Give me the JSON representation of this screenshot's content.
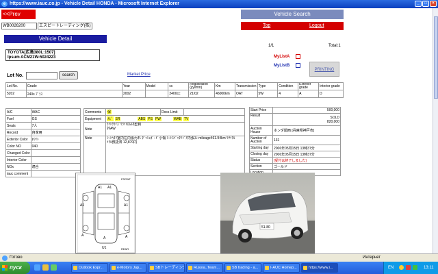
{
  "window": {
    "title": "https://www.iauc.co.jp - Vehicle Detail HONDA - Microsoft Internet Explorer"
  },
  "nav": {
    "prev": "<<Prev",
    "vehicle_search": "Vehicle Search",
    "top": "Top",
    "logout": "Logout"
  },
  "user": {
    "id": "WB0026200",
    "company": "エスピートレーディング(株)"
  },
  "detail": {
    "header": "Vehicle Detail",
    "page": "1/1",
    "total": "Total:1",
    "vehicle_line1": "TOYOTA[広島380L:1507]",
    "vehicle_line2": "Ipsum ACM21W-5024223",
    "mylist_a": "MyListA",
    "mylist_b": "MyListB",
    "printing": "PRINTING",
    "lot_label": "Lot No.",
    "search": "search",
    "market_price": "Market Price"
  },
  "spec": {
    "headers": [
      "Lot No.",
      "Grade",
      "Year",
      "Model",
      "cc",
      "Registration (yy/mm)",
      "Km",
      "Transmission",
      "Type",
      "Condition",
      "Exterior grade",
      "Interior grade"
    ],
    "values": [
      "5202",
      "240s ﾌﾟﾗｽ",
      "2002",
      "",
      "2400cc",
      "21/02",
      "46000km",
      "OAT",
      "5W",
      "4",
      "A",
      "D"
    ]
  },
  "info": {
    "ac_label": "A/C",
    "ac": "WAC",
    "fuel_label": "Fuel",
    "fuel": "GS",
    "seats_label": "Seats",
    "seats": "7人",
    "record_label": "Record",
    "record": "自家用",
    "ext_color_label": "Exterior Color",
    "ext_color": "ﾎﾜｲﾄ",
    "color_no_label": "Color NO",
    "color_no": "040",
    "changed_color_label": "Changed Color",
    "changed_color": "",
    "int_color_label": "Interior Color",
    "int_color": "",
    "nox_label": "NOx",
    "nox": "適合",
    "iauc_comment_label": "iauc comment",
    "iauc_comment": "",
    "comments_label": "Comments",
    "comments": "保",
    "docs_label": "Docs Limit",
    "docs": "",
    "equipment_label": "Equipment",
    "equipment": [
      "ﾅﾋﾞ",
      "SR",
      "ABS",
      "PS",
      "PW",
      "WAB",
      "TV"
    ],
    "note1_label": "Note",
    "note1_lines": [
      "ﾗｲﾄｸﾗｲｽﾞﾘﾗｲﾄﾛﾑﾙ3型目",
      "外AW"
    ],
    "note2_label": "Note",
    "note2_lines": [
      "ｼｰﾄﾍﾀﾘ室内左内張汚れ ﾀﾞｯｼｭﾎﾞｰﾄﾞ小傷 ｼｰﾄｽﾍﾞｯﾀﾘﾄﾞｱ内張ｽﾚ mileage461.94km ﾘｻｲｸﾙ",
      "ｲｸﾙ預託済 12,870円"
    ]
  },
  "auction": {
    "start_price_label": "Start Price",
    "start_price": "500,000",
    "result_label": "Result",
    "result_1": "SOLD",
    "result_2": "820,000",
    "auction_house_label": "Auction House",
    "auction_house": "ホンダ関西 [兵庫県神戸市]",
    "number_label": "Number of Auction",
    "number": "131",
    "starting_label": "Starting day",
    "starting": "2006年05月15日 13時37分",
    "closing_label": "Closing day",
    "closing": "2006年05月15日 13時37分",
    "status_label": "Status",
    "status": "[受付は終了しました]",
    "section_label": "Section",
    "section": "ゴールド",
    "location_label": "Location",
    "location": ""
  },
  "sheet": {
    "front": "FRONT",
    "rear": "REAR",
    "marks": [
      "A1",
      "A1",
      "A1",
      "A1",
      "A",
      "A",
      "A",
      "U1"
    ]
  },
  "photo": {
    "plate": "51-80"
  },
  "status_bar": {
    "done": "Готово",
    "zone": "Интернет"
  },
  "taskbar": {
    "start": "пуск",
    "tasks": [
      "Outlook Expr...",
      "e-Motors Jap...",
      "SBトレーディング",
      "Russia_Team...",
      "SB trading - a...",
      "I-AUC Homep...",
      "https://www.i..."
    ],
    "lang": "EN",
    "time": "13:11"
  }
}
